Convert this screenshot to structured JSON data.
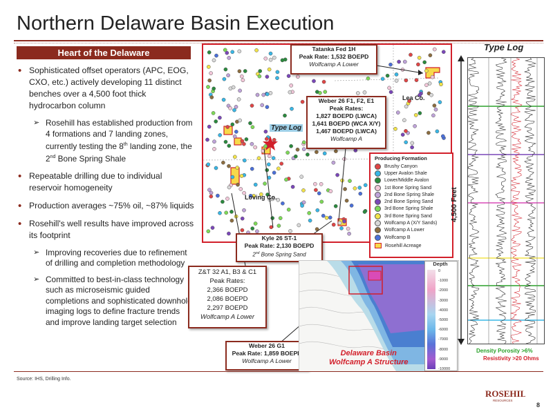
{
  "slide": {
    "title": "Northern Delaware Basin Execution",
    "page_number": "8",
    "source": "Source: IHS, Drilling Info."
  },
  "left_panel": {
    "banner": "Heart of the Delaware",
    "bullet1": "Sophisticated offset operators (APC, EOG, CXO, etc.) actively developing 11 distinct benches over a 4,500 foot thick hydrocarbon column",
    "bullet1_sub": "Rosehill has established production from 4 formations and 7 landing zones, currently testing the 8th landing zone, the 2nd Bone Spring Shale",
    "bullet2": "Repeatable drilling due to individual reservoir homogeneity",
    "bullet3": "Production averages ~75% oil, ~87% liquids",
    "bullet4": "Rosehill's well results have improved across its footprint",
    "bullet4_sub1": "Improving recoveries due to refinement of drilling and completion methodology",
    "bullet4_sub2": "Committed to best-in-class technology such as microseismic guided completions and sophisticated downhole imaging logs to define fracture trends and improve landing target selection"
  },
  "map": {
    "lea_label": "Lea Co.",
    "loving_label": "Loving Co.",
    "type_log_label": "Type Log"
  },
  "callouts": {
    "tatanka": {
      "l1": "Tatanka Fed 1H",
      "l2": "Peak Rate: 1,532 BOEPD",
      "l3": "Wolfcamp A Lower"
    },
    "weber_f": {
      "l1": "Weber 26 F1, F2, E1",
      "l2": "Peak Rates:",
      "l3": "1,827 BOEPD (LWCA)",
      "l4": "1,641 BOEPD (WCA  X/Y)",
      "l5": "1,467 BOEPD (LWCA)",
      "l6": "Wolfcamp A"
    },
    "kyle": {
      "l1": "Kyle 26 ST-1",
      "l2": "Peak Rate: 2,130 BOEPD",
      "l3": "2nd Bone Spring Sand"
    },
    "zt": {
      "l1": "Z&T 32  A1, B3 & C1",
      "l2": "Peak Rates:",
      "l3": "2,366 BOEPD",
      "l4": "2,086 BOEPD",
      "l5": "2,297 BOEPD",
      "l6": "Wolfcamp A Lower"
    },
    "weber_g": {
      "l1": "Weber 26 G1",
      "l2": "Peak Rate: 1,859 BOEPD",
      "l3": "Wolfcamp A Lower"
    }
  },
  "producing_legend": {
    "title": "Producing Formation",
    "items": [
      {
        "label": "Brushy Canyon",
        "color": "#e04545"
      },
      {
        "label": "Upper Avalon Shale",
        "color": "#39b7e6"
      },
      {
        "label": "Lower/Middle Avalon",
        "color": "#2b8a3e"
      },
      {
        "label": "1st Bone Spring Sand",
        "color": "#f2c7d9"
      },
      {
        "label": "2nd Bone Spring Shale",
        "color": "#bfa3d9"
      },
      {
        "label": "2nd Bone Spring Sand",
        "color": "#7a47b8"
      },
      {
        "label": "3rd Bone Spring Shale",
        "color": "#7ed957"
      },
      {
        "label": "3rd Bone Spring Sand",
        "color": "#f2e34a"
      },
      {
        "label": "Wolfcamp A (X/Y Sands)",
        "color": "#d9d9d9"
      },
      {
        "label": "Wolfcamp A Lower",
        "color": "#8c6d3f"
      },
      {
        "label": "Wolfcamp B",
        "color": "#4a6fd9"
      }
    ],
    "acreage_label": "Rosehill Acreage"
  },
  "depth_legend": {
    "title": "Depth",
    "ticks": [
      "0",
      "-1000",
      "-2000",
      "-3000",
      "-4000",
      "-5000",
      "-6000",
      "-7000",
      "-8000",
      "-9000",
      "-10000"
    ]
  },
  "lower_map": {
    "basin_line1": "Delaware Basin",
    "basin_line2": "Wolfcamp A Structure"
  },
  "type_log": {
    "title": "Type Log",
    "thickness_label": "4,500 Feet",
    "density_label": "Density Porosity >6%",
    "resistivity_label": "Resistivity >20 Ohms"
  },
  "colors": {
    "brand": "#8b2a1e",
    "acreage_red": "#d21f2a",
    "acreage_fill": "#f7d94a"
  }
}
